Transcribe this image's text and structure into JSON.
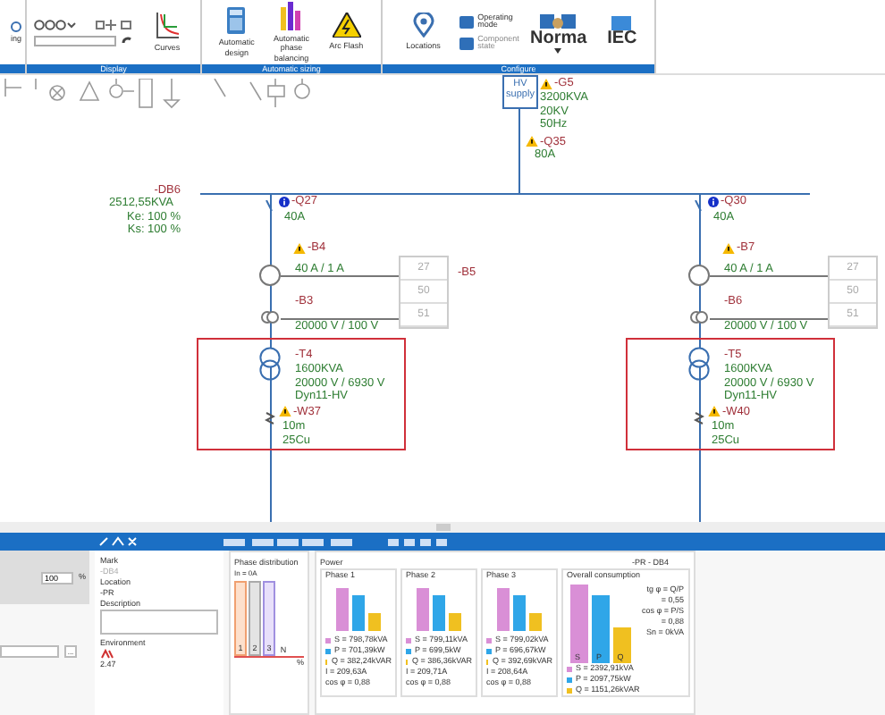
{
  "ribbon": {
    "cut_label": "ing",
    "groups": [
      {
        "label": "Display",
        "buttons": [
          {
            "kind": "curves",
            "label": "Curves",
            "disabled": false
          }
        ]
      },
      {
        "label": "Automatic sizing",
        "buttons": [
          {
            "kind": "calculator",
            "label": "Automatic design",
            "disabled": false
          },
          {
            "kind": "bars",
            "label": "Automatic phase balancing",
            "disabled": false
          },
          {
            "kind": "warning",
            "label": "Arc Flash",
            "disabled": false
          }
        ]
      },
      {
        "label": "Configure",
        "buttons": [
          {
            "kind": "location",
            "label": "Locations",
            "disabled": false
          },
          {
            "kind": "small",
            "label": "Operating mode",
            "disabled": false
          },
          {
            "kind": "small",
            "label": "Component state",
            "disabled": true
          },
          {
            "kind": "norma",
            "label": "Norma",
            "disabled": false
          },
          {
            "kind": "iec",
            "label": "IEC",
            "disabled": false
          }
        ]
      }
    ]
  },
  "supply": {
    "box": "HV supply",
    "name": "-G5",
    "lines": [
      "3200KVA",
      "20KV",
      "50Hz"
    ],
    "breaker": "-Q35",
    "rating": "80A"
  },
  "board": {
    "name": "-DB6",
    "lines": [
      "2512,55KVA",
      "Ke: 100 %",
      "Ks: 100 %"
    ]
  },
  "feeders": [
    {
      "breaker": "-Q27",
      "rating": "40A",
      "ct": "-B4",
      "ct_ratio": "40 A / 1 A",
      "vt": "-B3",
      "vt_ratio": "20000 V / 100 V",
      "relays": [
        "27",
        "50",
        "51"
      ],
      "relay_name": "-B5",
      "transformer": "-T4",
      "t_lines": [
        "1600KVA",
        "20000 V / 6930 V",
        "Dyn11-HV"
      ],
      "cable": "-W37",
      "c_lines": [
        "10m",
        "25Cu"
      ]
    },
    {
      "breaker": "-Q30",
      "rating": "40A",
      "ct": "-B7",
      "ct_ratio": "40 A / 1 A",
      "vt": "-B6",
      "vt_ratio": "20000 V / 100 V",
      "relays": [
        "27",
        "50",
        "51"
      ],
      "transformer": "-T5",
      "t_lines": [
        "1600KVA",
        "20000 V / 6930 V",
        "Dyn11-HV"
      ],
      "cable": "-W40",
      "c_lines": [
        "10m",
        "25Cu"
      ]
    }
  ],
  "panel": {
    "percent": {
      "value": "100",
      "unit": "%"
    },
    "dropdown_button": "...",
    "mark": {
      "label": "Mark",
      "value": "-DB4"
    },
    "location": {
      "label": "Location",
      "value": "-PR"
    },
    "description": {
      "label": "Description"
    },
    "environment": {
      "label": "Environment",
      "value": "2.47"
    },
    "phase_distribution": {
      "title": "Phase distribution",
      "current": "In = 0A",
      "bars": [
        "1",
        "2",
        "3",
        "N"
      ],
      "unit": "%"
    },
    "power": {
      "title": "Power",
      "board": "-PR - DB4",
      "phases": [
        {
          "title": "Phase 1",
          "lines": [
            "S = 798,78kVA",
            "P = 701,39kW",
            "Q = 382,24kVAR",
            "I = 209,63A",
            "cos φ = 0,88"
          ]
        },
        {
          "title": "Phase 2",
          "lines": [
            "S = 799,11kVA",
            "P = 699,5kW",
            "Q = 386,36kVAR",
            "I = 209,71A",
            "cos φ = 0,88"
          ]
        },
        {
          "title": "Phase 3",
          "lines": [
            "S = 799,02kVA",
            "P = 696,67kW",
            "Q = 392,69kVAR",
            "I = 208,64A",
            "cos φ = 0,88"
          ]
        }
      ]
    },
    "overall": {
      "title": "Overall consumption",
      "ratios": [
        "tg φ = Q/P",
        "= 0,55",
        "cos φ = P/S",
        "= 0,88",
        "Sn = 0kVA"
      ],
      "lines": [
        "S = 2392,91kVA",
        "P = 2097,75kW",
        "Q = 1151,26kVAR"
      ],
      "bar_labels": [
        "S",
        "P",
        "Q"
      ]
    }
  }
}
